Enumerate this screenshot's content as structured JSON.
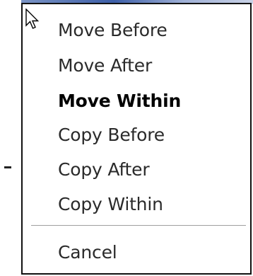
{
  "context_menu": {
    "items": [
      {
        "label": "Move Before",
        "bold": false
      },
      {
        "label": "Move After",
        "bold": false
      },
      {
        "label": "Move Within",
        "bold": true
      },
      {
        "label": "Copy Before",
        "bold": false
      },
      {
        "label": "Copy After",
        "bold": false
      },
      {
        "label": "Copy Within",
        "bold": false
      }
    ],
    "cancel_label": "Cancel"
  },
  "colors": {
    "menu_background": "#ffffff",
    "menu_border": "#111111",
    "text": "#2a2a2a",
    "separator": "#a0a0a0"
  },
  "icons": {
    "cursor": "mouse-pointer-arrow-icon"
  }
}
